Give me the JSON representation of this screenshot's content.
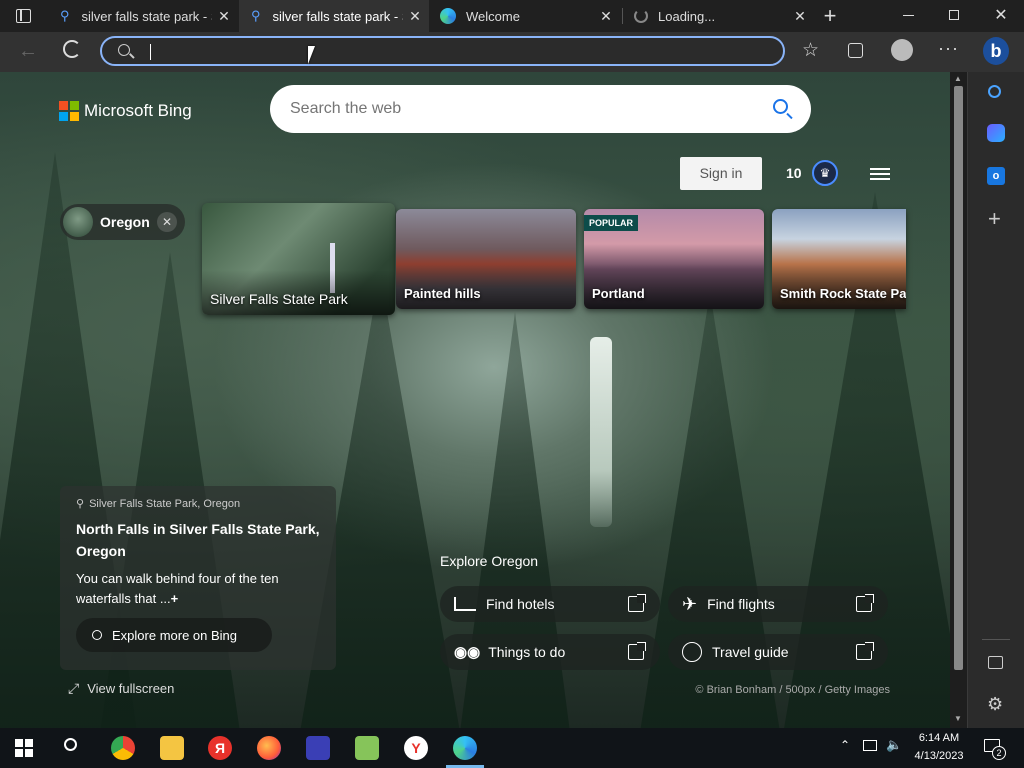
{
  "tabs": [
    {
      "title": "silver falls state park - S",
      "active": false
    },
    {
      "title": "silver falls state park - S",
      "active": true
    },
    {
      "title": "Welcome",
      "active": false
    },
    {
      "title": "Loading...",
      "active": false
    }
  ],
  "address_bar": {
    "value": "",
    "placeholder": ""
  },
  "bing": {
    "logo_text": "Microsoft Bing",
    "search_placeholder": "Search the web",
    "sign_in": "Sign in",
    "rewards_points": "10"
  },
  "topic": {
    "chip_label": "Oregon",
    "cards": [
      {
        "label": "Silver Falls State Park",
        "badge": ""
      },
      {
        "label": "Painted hills",
        "badge": ""
      },
      {
        "label": "Portland",
        "badge": "POPULAR"
      },
      {
        "label": "Smith Rock State Park",
        "badge": ""
      }
    ]
  },
  "info_panel": {
    "location": "Silver Falls State Park, Oregon",
    "title": "North Falls in Silver Falls State Park, Oregon",
    "description": "You can walk behind four of the ten waterfalls that ...",
    "more_symbol": "+",
    "explore_button": "Explore more on Bing",
    "fullscreen": "View fullscreen"
  },
  "explore": {
    "heading": "Explore Oregon",
    "buttons": [
      {
        "label": "Find hotels",
        "icon": "bed-icon"
      },
      {
        "label": "Find flights",
        "icon": "airplane-icon"
      },
      {
        "label": "Things to do",
        "icon": "binoculars-icon"
      },
      {
        "label": "Travel guide",
        "icon": "compass-icon"
      }
    ]
  },
  "credit": "© Brian Bonham / 500px / Getty Images",
  "taskbar": {
    "time": "6:14 AM",
    "date": "4/13/2023",
    "notification_count": "2"
  }
}
